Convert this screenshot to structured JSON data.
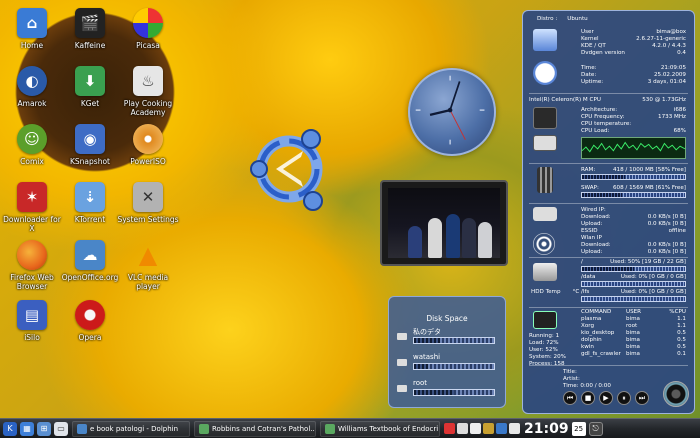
{
  "desktop_icons": [
    {
      "label": "Home",
      "icon": "home-folder-icon",
      "color": "#3a7bd5"
    },
    {
      "label": "Kaffeine",
      "icon": "film-clapper-icon",
      "color": "#222222"
    },
    {
      "label": "Picasa",
      "icon": "picasa-icon",
      "color": "#cc3322"
    },
    {
      "label": "Amarok",
      "icon": "amarok-wolf-icon",
      "color": "#2a5aa8"
    },
    {
      "label": "KGet",
      "icon": "download-arrow-icon",
      "color": "#3aa050"
    },
    {
      "label": "Play Cooking Academy",
      "icon": "chef-icon",
      "color": "#d7d7d7"
    },
    {
      "label": "Comix",
      "icon": "android-robot-icon",
      "color": "#5b9f2a"
    },
    {
      "label": "KSnapshot",
      "icon": "camera-icon",
      "color": "#3e6cc5"
    },
    {
      "label": "PowerISO",
      "icon": "disc-icon",
      "color": "#e08a20"
    },
    {
      "label": "Downloader for X",
      "icon": "star-splash-icon",
      "color": "#c82828"
    },
    {
      "label": "KTorrent",
      "icon": "torrent-arrow-icon",
      "color": "#6aa2e0"
    },
    {
      "label": "System Settings",
      "icon": "tools-icon",
      "color": "#b2b2b2"
    },
    {
      "label": "Firefox Web Browser",
      "icon": "firefox-icon",
      "color": "#e8671c"
    },
    {
      "label": "OpenOffice.org",
      "icon": "openoffice-icon",
      "color": "#4a86c8"
    },
    {
      "label": "VLC media player",
      "icon": "vlc-cone-icon",
      "color": "#f08a00"
    },
    {
      "label": "iSilo",
      "icon": "isilo-icon",
      "color": "#3b5fc0"
    },
    {
      "label": "Opera",
      "icon": "opera-icon",
      "color": "#cc1a1a"
    }
  ],
  "sysinfo": {
    "distro_label": "Distro :",
    "distro": "Ubuntu",
    "system": [
      [
        "User",
        "bima@box"
      ],
      [
        "Kernel",
        "2.6.27-11-generic"
      ],
      [
        "KDE / QT",
        "4.2.0 / 4.4.3"
      ],
      [
        "Dvdgen version",
        "0.4"
      ]
    ],
    "time": [
      [
        "Time:",
        "21:09:05"
      ],
      [
        "Date:",
        "25.02.2009"
      ],
      [
        "Uptime:",
        "3 days, 01:04"
      ]
    ],
    "cpu_title": "Intel(R) Celeron(R) M CPU",
    "cpu_speed": "530 @ 1.73GHz",
    "cpu": [
      [
        "Architecture:",
        "i686"
      ],
      [
        "CPU Frequency:",
        "1733 MHz"
      ],
      [
        "CPU temperature:",
        ""
      ],
      [
        "CPU Load:",
        "68%"
      ]
    ],
    "ram_label": "RAM:",
    "ram_value": "418 / 1000 MB [58% Free]",
    "ram_used": 0.42,
    "swap_label": "SWAP:",
    "swap_value": "608 / 1569 MB [61% Free]",
    "swap_used": 0.39,
    "net": [
      [
        "Wired IP:",
        ""
      ],
      [
        "Download:",
        "0.0 KB/s   [0 B]"
      ],
      [
        "Upload:",
        "0.0 KB/s   [0 B]"
      ],
      [
        "ESSID",
        "offline"
      ],
      [
        "Wlan IP",
        ""
      ],
      [
        "Download:",
        "0.0 KB/s   [0 B]"
      ],
      [
        "Upload:",
        "0.0 KB/s   [0 B]"
      ]
    ],
    "hdd_temp_label": "HDD Temp",
    "hdd_temp_unit": "°C",
    "disks": [
      {
        "name": "/",
        "value": "Used: 50% [19 GB / 22 GB]",
        "used": 0.5
      },
      {
        "name": "/data",
        "value": "Used: 0% [0 GB / 0 GB]",
        "used": 0.0
      },
      {
        "name": "/lfs",
        "value": "Used: 0% [0 GB / 0 GB]",
        "used": 0.0
      }
    ],
    "proc_headers": [
      "COMMAND",
      "USER",
      "%CPU"
    ],
    "processes": [
      [
        "plasma",
        "bima",
        "1.1"
      ],
      [
        "Xorg",
        "root",
        "1.1"
      ],
      [
        "kio_desktop",
        "bima",
        "0.5"
      ],
      [
        "dolphin",
        "bima",
        "0.5"
      ],
      [
        "kwin",
        "bima",
        "0.5"
      ],
      [
        "gdl_fs_crawler",
        "bima",
        "0.1"
      ]
    ],
    "proc_stats": [
      [
        "Running:",
        "1"
      ],
      [
        "Load:",
        "72%"
      ],
      [
        "User:",
        "52%"
      ],
      [
        "System:",
        "20%"
      ],
      [
        "Process:",
        "158"
      ]
    ],
    "player": [
      [
        "Title:",
        ""
      ],
      [
        "Artist:",
        ""
      ],
      [
        "Time:",
        "0:00 / 0:00"
      ]
    ]
  },
  "disk_widget": {
    "title": "Disk Space",
    "rows": [
      {
        "name": "私のデタ",
        "used": 0.32
      },
      {
        "name": "watashi",
        "used": 0.18
      },
      {
        "name": "root",
        "used": 0.5
      }
    ]
  },
  "taskbar": {
    "tasks": [
      {
        "label": "e book patologi - Dolphin",
        "color": "#4a86c8"
      },
      {
        "label": "Robbins and Cotran's Pathol...",
        "color": "#5aa860"
      },
      {
        "label": "Williams Textbook of Endocri...",
        "color": "#5aa860"
      }
    ],
    "time": "21:09",
    "date": "25"
  }
}
